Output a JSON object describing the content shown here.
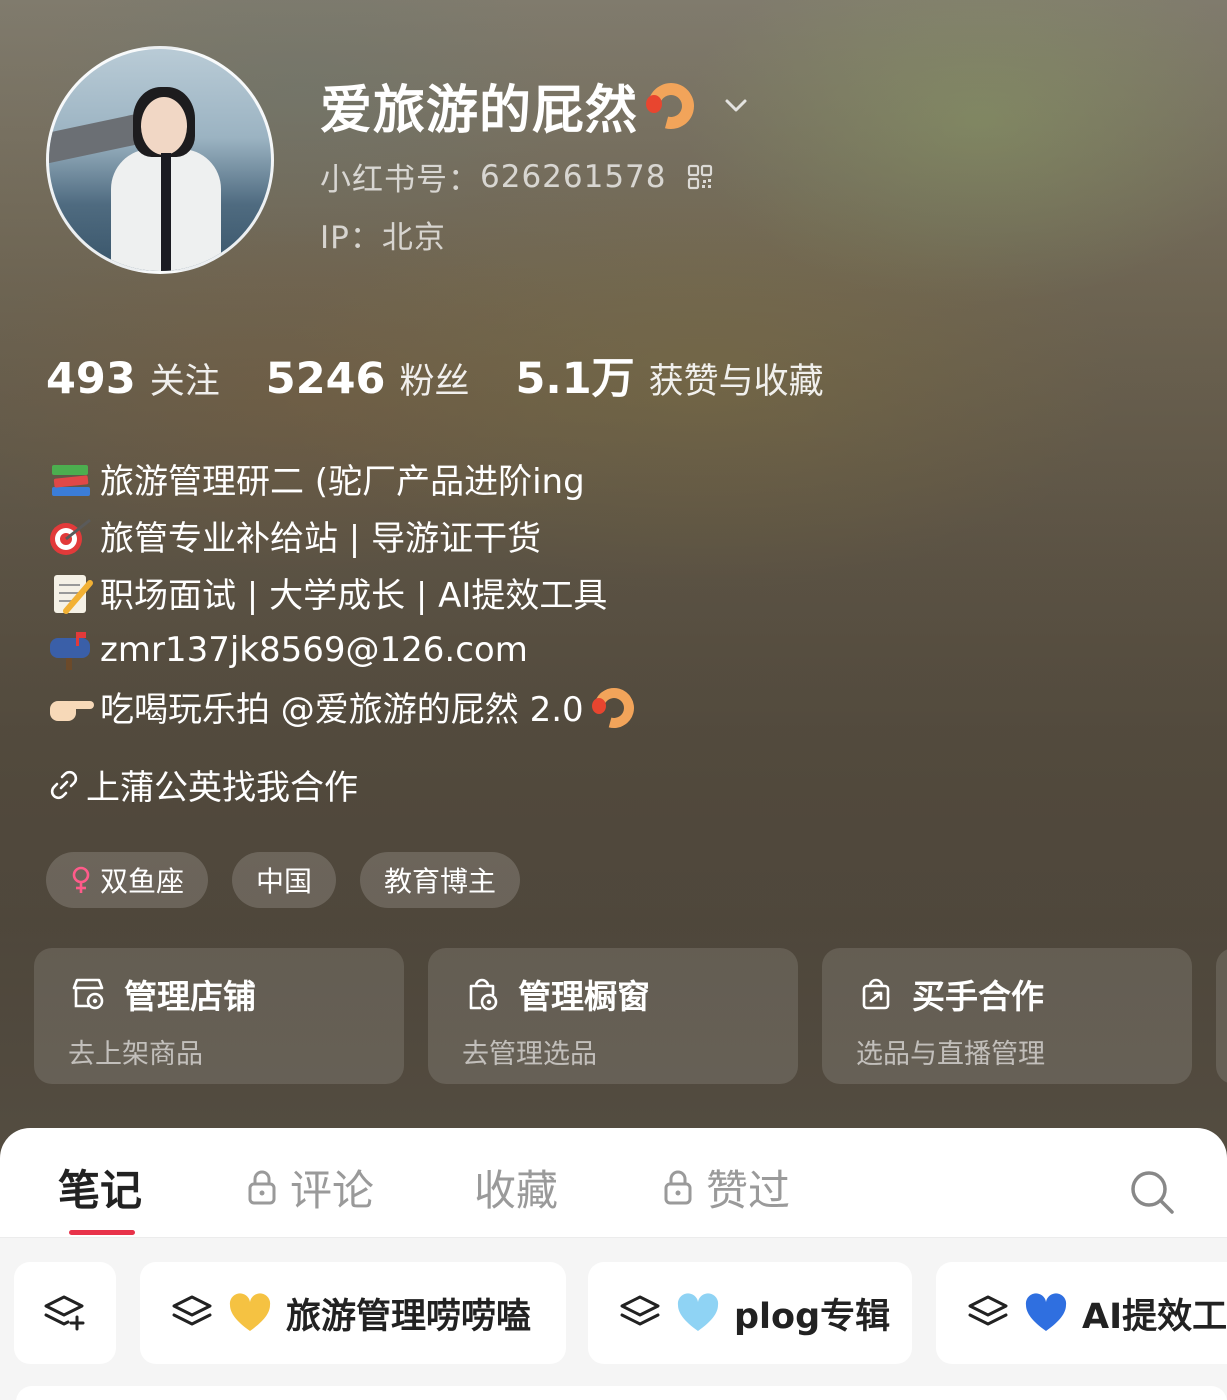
{
  "profile": {
    "name": "爱旅游的屁然",
    "name_emoji": "shrimp-emoji",
    "id_label": "小红书号：",
    "id_value": "626261578",
    "ip_label": "IP：",
    "ip_value": "北京"
  },
  "stats": [
    {
      "value": "493",
      "label": "关注"
    },
    {
      "value": "5246",
      "label": "粉丝"
    },
    {
      "value": "5.1万",
      "label": "获赞与收藏"
    }
  ],
  "bio": [
    {
      "icon": "books-emoji",
      "text": "旅游管理研二 (驼厂产品进阶ing"
    },
    {
      "icon": "target-emoji",
      "text": "旅管专业补给站 | 导游证干货"
    },
    {
      "icon": "memo-emoji",
      "text": "职场面试 | 大学成长 | AI提效工具"
    },
    {
      "icon": "mailbox-emoji",
      "text": "zmr137jk8569@126.com"
    },
    {
      "icon": "pointing-hand-emoji",
      "text": "吃喝玩乐拍 @爱旅游的屁然 2.0"
    }
  ],
  "collab_link": "上蒲公英找我合作",
  "tags": [
    "双鱼座",
    "中国",
    "教育博主"
  ],
  "cards": [
    {
      "title": "管理店铺",
      "subtitle": "去上架商品",
      "icon": "shop-icon"
    },
    {
      "title": "管理橱窗",
      "subtitle": "去管理选品",
      "icon": "showcase-icon"
    },
    {
      "title": "买手合作",
      "subtitle": "选品与直播管理",
      "icon": "bag-icon"
    }
  ],
  "tabs": [
    {
      "label": "笔记",
      "locked": false,
      "active": true
    },
    {
      "label": "评论",
      "locked": true,
      "active": false
    },
    {
      "label": "收藏",
      "locked": false,
      "active": false
    },
    {
      "label": "赞过",
      "locked": true,
      "active": false
    }
  ],
  "albums": [
    {
      "label": "旅游管理唠唠嗑",
      "heart_color": "#f5c242"
    },
    {
      "label": "plog专辑",
      "heart_color": "#8fd3f4"
    },
    {
      "label": "AI提效工",
      "heart_color": "#2f6fe0"
    }
  ],
  "colors": {
    "accent": "#e8334a",
    "female": "#ff5b8a"
  }
}
